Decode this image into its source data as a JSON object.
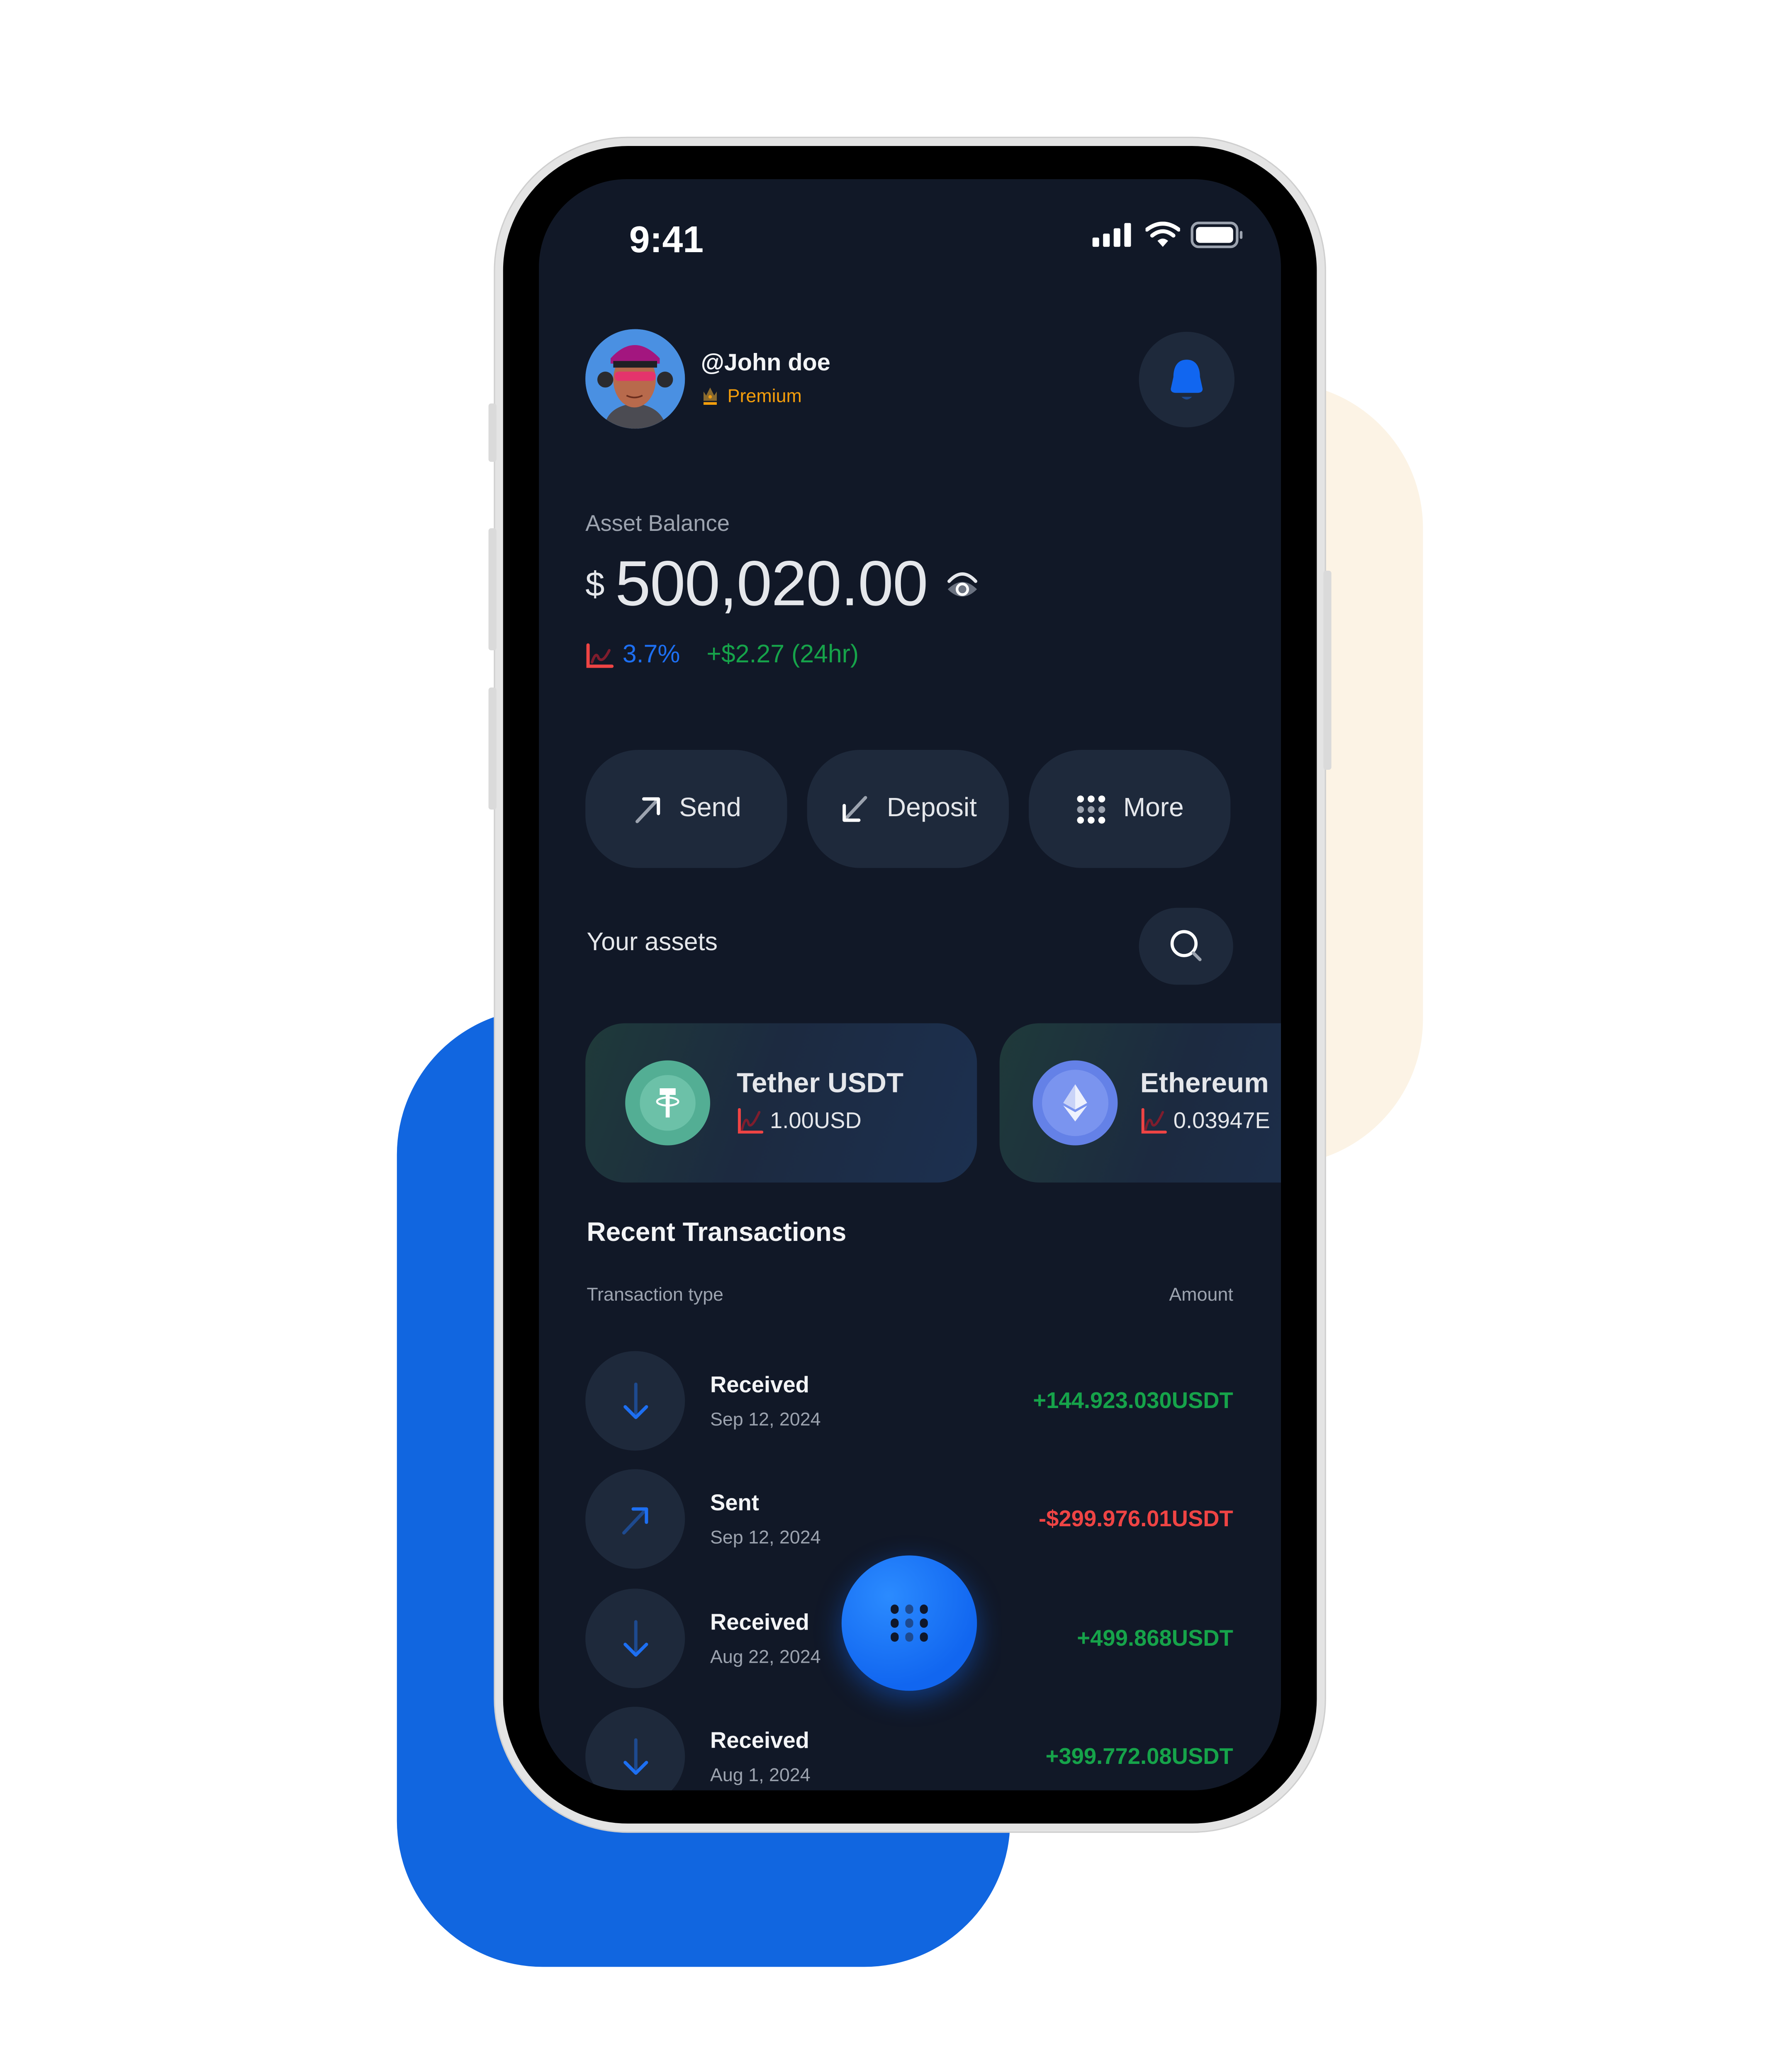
{
  "status_bar": {
    "time": "9:41"
  },
  "profile": {
    "username": "@John doe",
    "tier": "Premium"
  },
  "balance": {
    "label": "Asset Balance",
    "currency_symbol": "$",
    "amount": "500,020.00",
    "change_percent": "3.7%",
    "change_value": "+$2.27 (24hr)"
  },
  "actions": [
    {
      "label": "Send",
      "icon": "arrow-up-right-icon"
    },
    {
      "label": "Deposit",
      "icon": "arrow-down-left-icon"
    },
    {
      "label": "More",
      "icon": "grid-dots-icon"
    }
  ],
  "assets": {
    "title": "Your assets",
    "items": [
      {
        "name": "Tether USDT",
        "price": "1.00USD",
        "icon": "tether-icon"
      },
      {
        "name": "Ethereum",
        "price": "0.03947E",
        "icon": "ethereum-icon"
      }
    ]
  },
  "transactions": {
    "title": "Recent Transactions",
    "col_type": "Transaction type",
    "col_amount": "Amount",
    "items": [
      {
        "type": "Received",
        "date": "Sep 12, 2024",
        "amount": "+144.923.030USDT",
        "direction": "in"
      },
      {
        "type": "Sent",
        "date": "Sep 12, 2024",
        "amount": "-$299.976.01USDT",
        "direction": "out"
      },
      {
        "type": "Received",
        "date": "Aug 22, 2024",
        "amount": "+499.868USDT",
        "direction": "in"
      },
      {
        "type": "Received",
        "date": "Aug 1, 2024",
        "amount": "+399.772.08USDT",
        "direction": "in"
      }
    ]
  },
  "colors": {
    "accent": "#1166f0",
    "positive": "#16a34a",
    "negative": "#ef4444",
    "premium": "#f59e0b",
    "screen_bg": "#111827",
    "surface": "#1e293b"
  }
}
